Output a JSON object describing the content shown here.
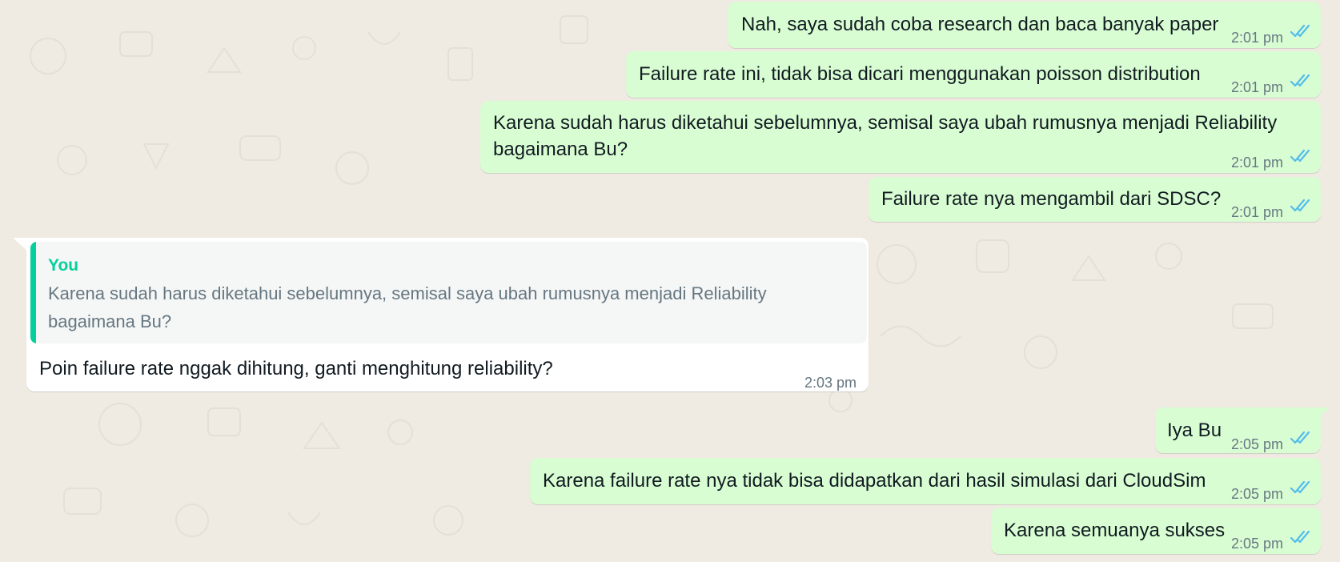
{
  "theme": {
    "wallpaper": "#efeae2",
    "outgoing_bubble": "#d9fdd3",
    "incoming_bubble": "#ffffff",
    "read_ticks": "#53bdeb",
    "quote_accent": "#06cf9c"
  },
  "messages": [
    {
      "text": "Nah, saya sudah coba research dan baca banyak paper",
      "time": "2:01 pm",
      "status": "read"
    },
    {
      "text": "Failure rate ini, tidak bisa dicari menggunakan poisson distribution",
      "time": "2:01 pm",
      "status": "read"
    },
    {
      "text": "Karena sudah harus diketahui sebelumnya, semisal saya ubah rumusnya menjadi Reliability bagaimana Bu?",
      "time": "2:01 pm",
      "status": "read"
    },
    {
      "text": "Failure rate nya mengambil dari SDSC?",
      "time": "2:01 pm",
      "status": "read"
    },
    {
      "quote": {
        "author": "You",
        "text": "Karena sudah harus diketahui sebelumnya, semisal saya ubah rumusnya menjadi Reliability bagaimana Bu?"
      },
      "text": "Poin failure rate nggak dihitung, ganti menghitung reliability?",
      "time": "2:03 pm"
    },
    {
      "text": "Iya Bu",
      "time": "2:05 pm",
      "status": "read"
    },
    {
      "text": "Karena failure rate nya tidak bisa didapatkan dari hasil simulasi dari CloudSim",
      "time": "2:05 pm",
      "status": "read"
    },
    {
      "text": "Karena semuanya sukses",
      "time": "2:05 pm",
      "status": "read"
    }
  ]
}
